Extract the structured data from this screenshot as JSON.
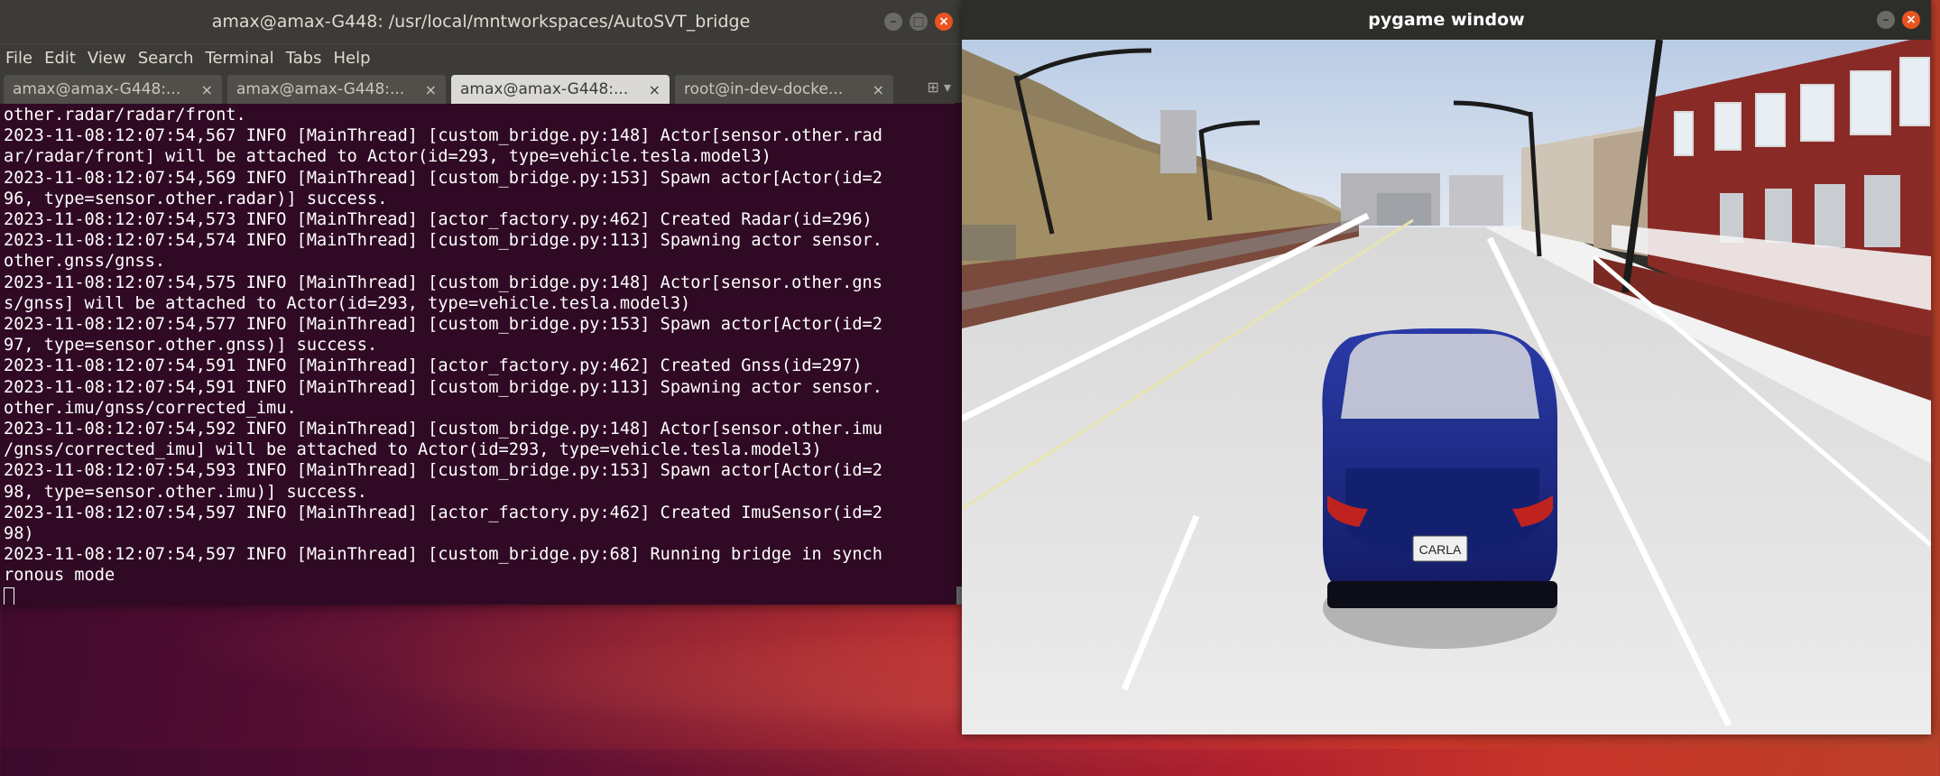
{
  "terminal": {
    "title": "amax@amax-G448: /usr/local/mntworkspaces/AutoSVT_bridge",
    "menu": [
      "File",
      "Edit",
      "View",
      "Search",
      "Terminal",
      "Tabs",
      "Help"
    ],
    "tabs": [
      {
        "label": "amax@amax-G448:...",
        "active": false
      },
      {
        "label": "amax@amax-G448:...",
        "active": false
      },
      {
        "label": "amax@amax-G448:...",
        "active": true
      },
      {
        "label": "root@in-dev-docke...",
        "active": false
      }
    ],
    "lines": [
      "other.radar/radar/front.",
      "2023-11-08:12:07:54,567 INFO [MainThread] [custom_bridge.py:148] Actor[sensor.other.rad",
      "ar/radar/front] will be attached to Actor(id=293, type=vehicle.tesla.model3)",
      "2023-11-08:12:07:54,569 INFO [MainThread] [custom_bridge.py:153] Spawn actor[Actor(id=2",
      "96, type=sensor.other.radar)] success.",
      "2023-11-08:12:07:54,573 INFO [MainThread] [actor_factory.py:462] Created Radar(id=296)",
      "2023-11-08:12:07:54,574 INFO [MainThread] [custom_bridge.py:113] Spawning actor sensor.",
      "other.gnss/gnss.",
      "2023-11-08:12:07:54,575 INFO [MainThread] [custom_bridge.py:148] Actor[sensor.other.gns",
      "s/gnss] will be attached to Actor(id=293, type=vehicle.tesla.model3)",
      "2023-11-08:12:07:54,577 INFO [MainThread] [custom_bridge.py:153] Spawn actor[Actor(id=2",
      "97, type=sensor.other.gnss)] success.",
      "2023-11-08:12:07:54,591 INFO [MainThread] [actor_factory.py:462] Created Gnss(id=297)",
      "2023-11-08:12:07:54,591 INFO [MainThread] [custom_bridge.py:113] Spawning actor sensor.",
      "other.imu/gnss/corrected_imu.",
      "2023-11-08:12:07:54,592 INFO [MainThread] [custom_bridge.py:148] Actor[sensor.other.imu",
      "/gnss/corrected_imu] will be attached to Actor(id=293, type=vehicle.tesla.model3)",
      "2023-11-08:12:07:54,593 INFO [MainThread] [custom_bridge.py:153] Spawn actor[Actor(id=2",
      "98, type=sensor.other.imu)] success.",
      "2023-11-08:12:07:54,597 INFO [MainThread] [actor_factory.py:462] Created ImuSensor(id=2",
      "98)",
      "2023-11-08:12:07:54,597 INFO [MainThread] [custom_bridge.py:68] Running bridge in synch",
      "ronous mode"
    ],
    "colors": {
      "background": "#300a24",
      "titlebar": "#3c3b37",
      "text": "#ffffff"
    }
  },
  "pygame": {
    "title": "pygame window",
    "plate_text": "CARLA",
    "colors": {
      "car_body": "#1e2a8a",
      "sky": "#c8d6ea",
      "road": "#e6e6e6",
      "building": "#8a2a26"
    }
  }
}
